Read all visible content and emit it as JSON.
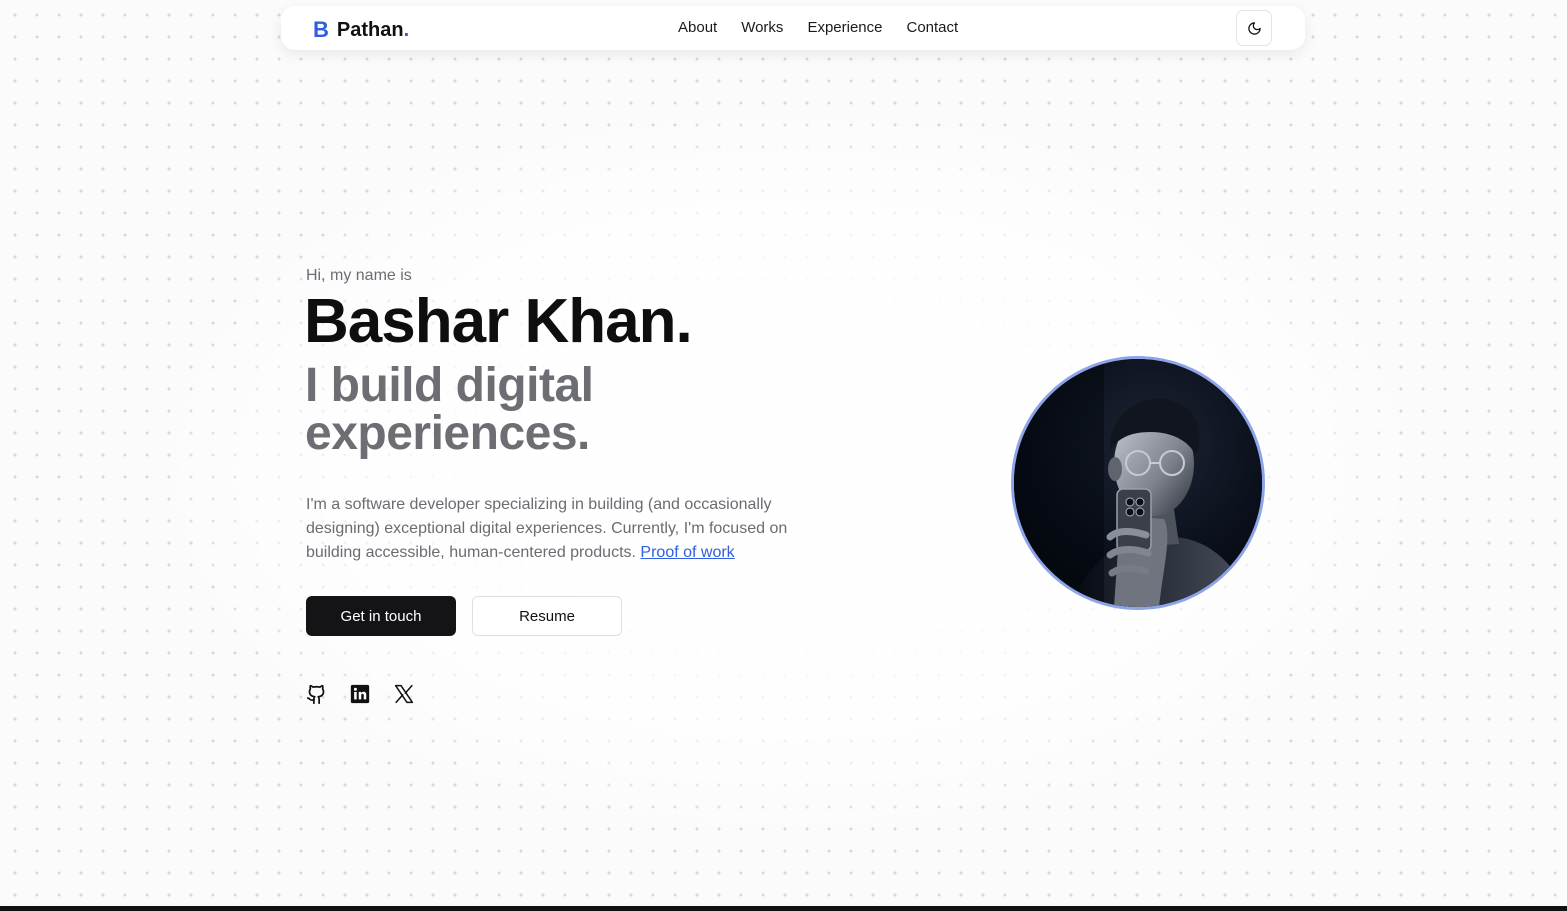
{
  "nav": {
    "logo_mark": "B",
    "logo_text": "Pathan",
    "logo_dot": ".",
    "links": [
      "About",
      "Works",
      "Experience",
      "Contact"
    ],
    "theme_toggle_icon": "moon-icon"
  },
  "hero": {
    "greeting": "Hi, my name is",
    "name": "Bashar Khan.",
    "tagline_line1": "I build digital",
    "tagline_line2": "experiences.",
    "bio": "I'm a software developer specializing in building (and occasionally designing) exceptional digital experiences. Currently, I'm focused on building accessible, human-centered products. ",
    "bio_link": "Proof of work",
    "primary_button": "Get in touch",
    "secondary_button": "Resume",
    "socials": [
      "github-icon",
      "linkedin-icon",
      "x-icon"
    ]
  },
  "colors": {
    "accent": "#2f5fe0",
    "text_dark": "#0e0e10",
    "text_muted": "#6d6e74",
    "avatar_ring": "#8ea4e8"
  }
}
